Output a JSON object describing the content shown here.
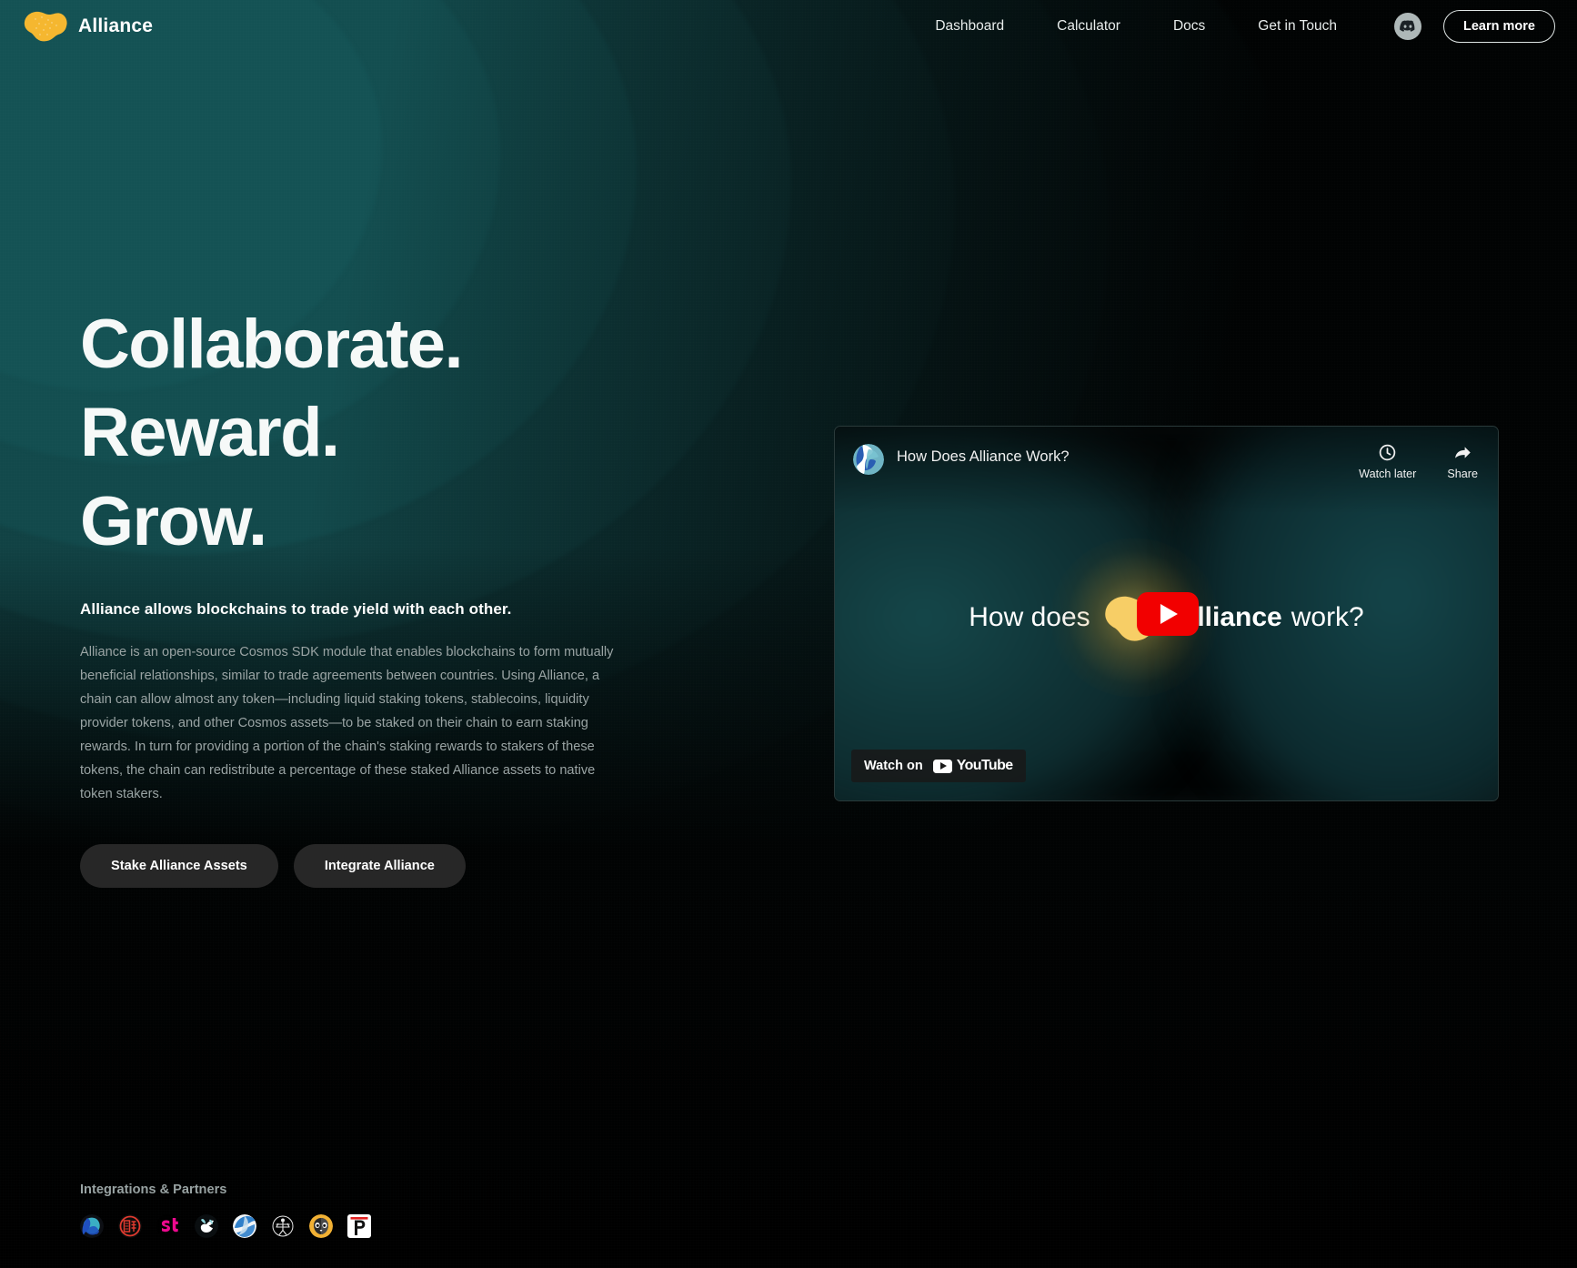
{
  "header": {
    "brand": {
      "name": "Alliance",
      "logo_icon": "alliance-blob-logo",
      "logo_color": "#F5B730"
    },
    "nav": [
      {
        "label": "Dashboard"
      },
      {
        "label": "Calculator"
      },
      {
        "label": "Docs"
      },
      {
        "label": "Get in Touch"
      }
    ],
    "discord_icon": "discord-icon",
    "cta_label": "Learn more"
  },
  "hero": {
    "headline_lines": [
      "Collaborate.",
      "Reward.",
      "Grow."
    ],
    "lede": "Alliance allows blockchains to trade yield with each other.",
    "paragraph": "Alliance is an open-source Cosmos SDK module that enables blockchains to form mutually beneficial relationships, similar to trade agreements between countries. Using Alliance, a chain can allow almost any token—including liquid staking tokens, stablecoins, liquidity provider tokens, and other Cosmos assets—to be staked on their chain to earn staking rewards. In turn for providing a portion of the chain's staking rewards to stakers of these tokens, the chain can redistribute a percentage of these staked Alliance assets to native token stakers.",
    "buttons": [
      {
        "label": "Stake Alliance Assets"
      },
      {
        "label": "Integrate Alliance"
      }
    ]
  },
  "video": {
    "title": "How Does Alliance Work?",
    "channel_avatar_icon": "channel-avatar-icon",
    "watch_later_label": "Watch later",
    "watch_later_icon": "clock-icon",
    "share_label": "Share",
    "share_icon": "share-arrow-icon",
    "overlay": {
      "prefix": "How does",
      "logo_icon": "alliance-blob-logo",
      "bold": "Alliance",
      "suffix": "work?"
    },
    "play_icon": "youtube-play-icon",
    "watch_on_label": "Watch on",
    "youtube_wordmark": "YouTube"
  },
  "partners": {
    "title": "Integrations & Partners",
    "logos": [
      {
        "name": "partner-logo-1"
      },
      {
        "name": "partner-logo-2"
      },
      {
        "name": "partner-logo-3"
      },
      {
        "name": "partner-logo-4"
      },
      {
        "name": "partner-logo-5"
      },
      {
        "name": "partner-logo-6"
      },
      {
        "name": "partner-logo-7"
      },
      {
        "name": "partner-logo-8"
      }
    ]
  },
  "colors": {
    "brand_amber": "#F5B730",
    "background": "#010303",
    "teal_glow": "#14494B",
    "youtube_red": "#F20000",
    "muted_text": "#9AA4A4"
  }
}
